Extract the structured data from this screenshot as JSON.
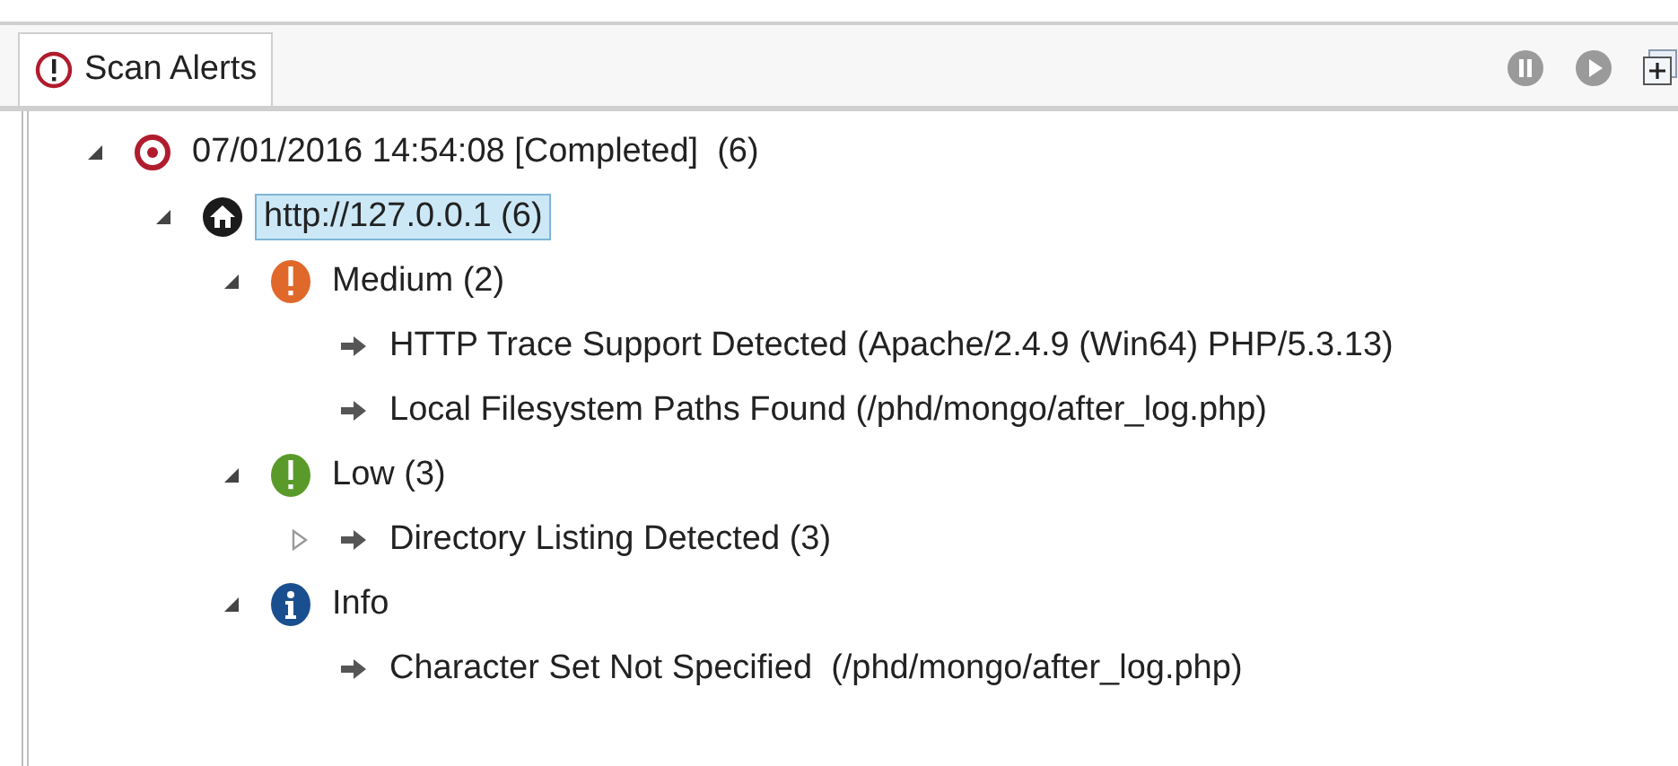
{
  "tab": {
    "label": "Scan Alerts",
    "selected": true
  },
  "toolbar": [
    {
      "kind": "pause",
      "disabled": true
    },
    {
      "kind": "play",
      "disabled": true
    },
    {
      "kind": "expand",
      "disabled": false
    }
  ],
  "tree": [
    {
      "kind": "scan",
      "label": "07/01/2016 14:54:08 [Completed]  (6)",
      "expanded": true,
      "selected": false,
      "children": [
        {
          "kind": "site",
          "label": "http://127.0.0.1 (6)",
          "expanded": true,
          "selected": true,
          "children": [
            {
              "kind": "medium",
              "label": "Medium (2)",
              "expanded": true,
              "selected": false,
              "children": [
                {
                  "kind": "alert",
                  "label": "HTTP Trace Support Detected (Apache/2.4.9 (Win64) PHP/5.3.13)",
                  "selected": false
                },
                {
                  "kind": "alert",
                  "label": "Local Filesystem Paths Found (/phd/mongo/after_log.php)",
                  "selected": false
                }
              ]
            },
            {
              "kind": "low",
              "label": "Low (3)",
              "expanded": true,
              "selected": false,
              "children": [
                {
                  "kind": "alert",
                  "label": "Directory Listing Detected (3)",
                  "expanded": false,
                  "selected": false
                }
              ]
            },
            {
              "kind": "info",
              "label": "Info",
              "expanded": true,
              "selected": false,
              "children": [
                {
                  "kind": "alert",
                  "label": "Character Set Not Specified  (/phd/mongo/after_log.php)",
                  "selected": false
                }
              ]
            }
          ]
        }
      ]
    }
  ]
}
